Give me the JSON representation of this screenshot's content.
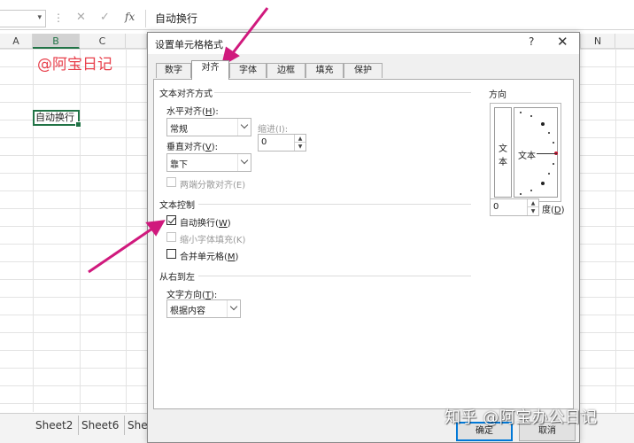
{
  "formula_bar": {
    "content": "自动换行",
    "fx_label": "fx"
  },
  "columns": [
    "A",
    "B",
    "C",
    "N"
  ],
  "cells": {
    "watermark": "@阿宝日记",
    "active_value": "自动换行"
  },
  "sheet_tabs": [
    "Sheet2",
    "Sheet6",
    "She"
  ],
  "dialog": {
    "title": "设置单元格格式",
    "help": "?",
    "close": "✕",
    "tabs": [
      {
        "label": "数字",
        "active": false
      },
      {
        "label": "对齐",
        "active": true
      },
      {
        "label": "字体",
        "active": false
      },
      {
        "label": "边框",
        "active": false
      },
      {
        "label": "填充",
        "active": false
      },
      {
        "label": "保护",
        "active": false
      }
    ],
    "alignment": {
      "section_title": "文本对齐方式",
      "horizontal_label": "水平对齐(",
      "horizontal_key": "H",
      "horizontal_value": "常规",
      "indent_label": "缩进(I):",
      "indent_value": "0",
      "vertical_label": "垂直对齐(",
      "vertical_key": "V",
      "vertical_value": "靠下",
      "distributed_label": "两端分散对齐(E)"
    },
    "text_control": {
      "section_title": "文本控制",
      "wrap_text": {
        "label": "自动换行(",
        "key": "W",
        "checked": true
      },
      "shrink_to_fit": {
        "label": "缩小字体填充(K)",
        "checked": false,
        "disabled": true
      },
      "merge_cells": {
        "label": "合并单元格(",
        "key": "M",
        "checked": false
      }
    },
    "rtl": {
      "section_title": "从右到左",
      "direction_label": "文字方向(",
      "direction_key": "T",
      "direction_value": "根据内容"
    },
    "orientation": {
      "section_title": "方向",
      "vertical_text": [
        "文",
        "本"
      ],
      "dial_text": "文本",
      "degrees_value": "0",
      "degrees_label": "度(",
      "degrees_key": "D"
    },
    "buttons": {
      "ok": "确定",
      "cancel": "取消"
    }
  },
  "overlay_watermark": "知乎 @阿宝办公日记",
  "colors": {
    "excel_green": "#217346",
    "arrow": "#d0197d",
    "watermark_red": "#e8404c"
  }
}
